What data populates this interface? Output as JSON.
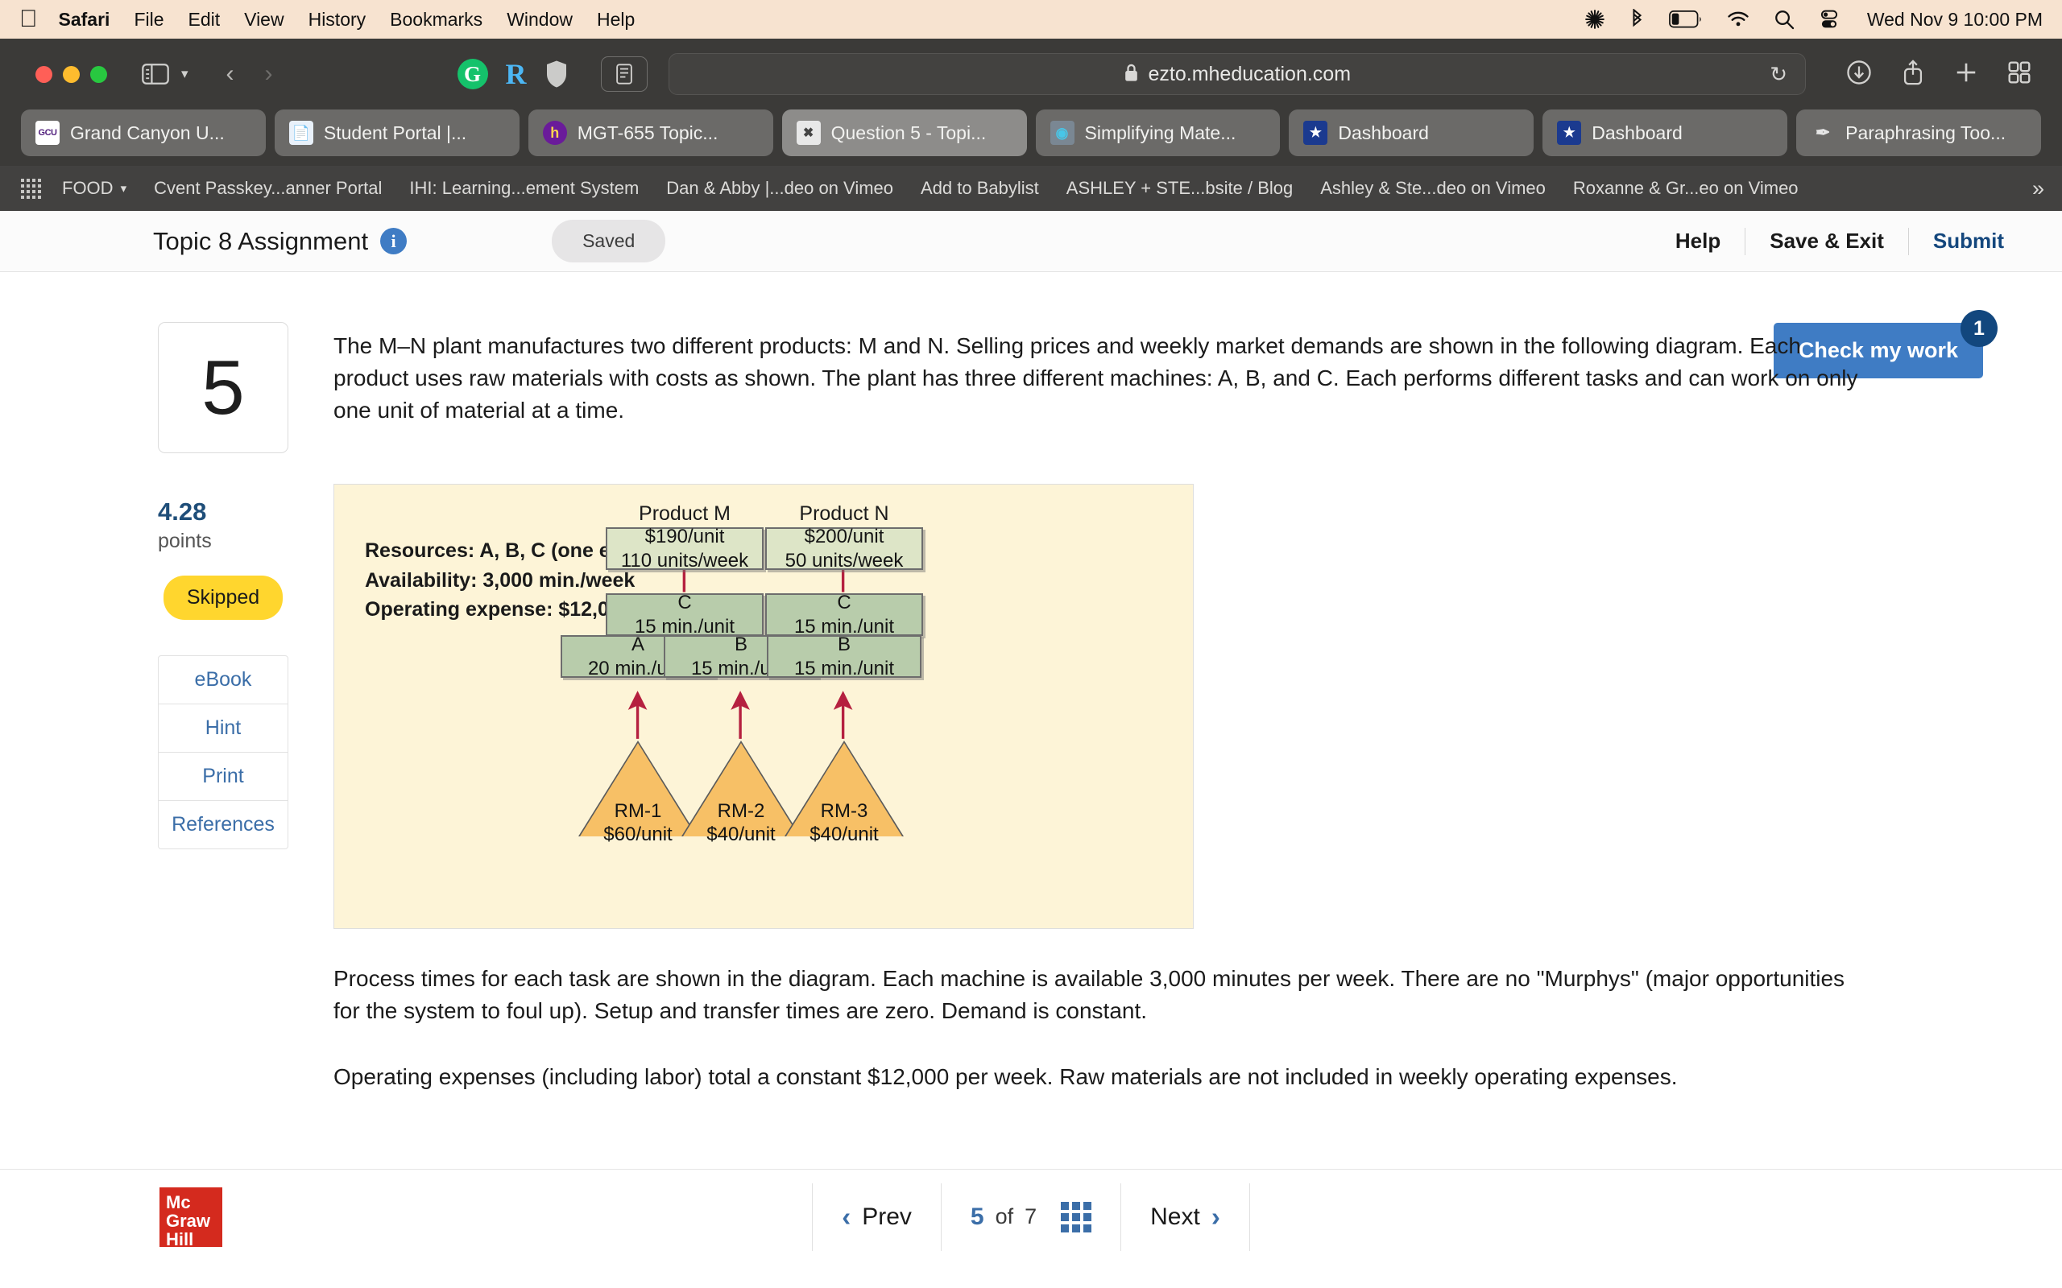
{
  "menubar": {
    "apple_icon": "apple-icon",
    "items": [
      {
        "label": "Safari",
        "bold": true
      },
      {
        "label": "File",
        "bold": false
      },
      {
        "label": "Edit",
        "bold": false
      },
      {
        "label": "View",
        "bold": false
      },
      {
        "label": "History",
        "bold": false
      },
      {
        "label": "Bookmarks",
        "bold": false
      },
      {
        "label": "Window",
        "bold": false
      },
      {
        "label": "Help",
        "bold": false
      }
    ],
    "status_icons": [
      "asterisk-icon",
      "bluetooth-icon",
      "battery-icon",
      "wifi-icon",
      "search-icon",
      "control-center-icon"
    ],
    "clock": "Wed Nov 9  10:00 PM"
  },
  "browser": {
    "window_controls": [
      "close-button",
      "minimize-button",
      "zoom-button"
    ],
    "sidebar_icon": "sidebar-icon",
    "tab_overview_chevron": "chevron-down-icon",
    "back_icon": "chevron-left-icon",
    "forward_icon": "chevron-right-icon",
    "extensions": [
      "grammarly-icon",
      "r-extension-icon",
      "shield-icon",
      "reader-icon"
    ],
    "url": "ezto.mheducation.com",
    "lock_icon": "lock-icon",
    "reload_icon": "reload-icon",
    "right_icons": [
      "downloads-icon",
      "share-icon",
      "new-tab-icon",
      "tab-overview-icon"
    ],
    "tabs": [
      {
        "title": "Grand Canyon U...",
        "favicon": "gcu-icon",
        "active": false
      },
      {
        "title": "Student Portal |...",
        "favicon": "portal-icon",
        "active": false
      },
      {
        "title": "MGT-655 Topic...",
        "favicon": "halo-icon",
        "active": false
      },
      {
        "title": "Question 5 - Topi...",
        "favicon": "connect-icon",
        "active": true
      },
      {
        "title": "Simplifying Mate...",
        "favicon": "simplify-icon",
        "active": false
      },
      {
        "title": "Dashboard",
        "favicon": "star-shield-icon",
        "active": false
      },
      {
        "title": "Dashboard",
        "favicon": "star-shield-icon",
        "active": false
      },
      {
        "title": "Paraphrasing Too...",
        "favicon": "quill-icon",
        "active": false
      }
    ],
    "bookmarks": [
      {
        "label": "FOOD",
        "has_chevron": true
      },
      {
        "label": "Cvent Passkey...anner Portal",
        "has_chevron": false
      },
      {
        "label": "IHI: Learning...ement System",
        "has_chevron": false
      },
      {
        "label": "Dan & Abby |...deo on Vimeo",
        "has_chevron": false
      },
      {
        "label": "Add to Babylist",
        "has_chevron": false
      },
      {
        "label": "ASHLEY + STE...bsite / Blog",
        "has_chevron": false
      },
      {
        "label": "Ashley & Ste...deo on Vimeo",
        "has_chevron": false
      },
      {
        "label": "Roxanne & Gr...eo on Vimeo",
        "has_chevron": false
      }
    ],
    "bookmarks_overflow": "»",
    "apps_grid_icon": "apps-grid-icon"
  },
  "app": {
    "title": "Topic 8 Assignment",
    "info_icon": "info-icon",
    "save_status": "Saved",
    "help_label": "Help",
    "save_exit_label": "Save & Exit",
    "submit_label": "Submit",
    "check_work_label": "Check my work",
    "check_work_badge": "1"
  },
  "question": {
    "number": "5",
    "points_value": "4.28",
    "points_label": "points",
    "status": "Skipped",
    "aids": [
      {
        "label": "eBook"
      },
      {
        "label": "Hint"
      },
      {
        "label": "Print"
      },
      {
        "label": "References"
      }
    ],
    "paragraph_1": "The M–N plant manufactures two different products: M and N. Selling prices and weekly market demands are shown in the following diagram. Each product uses raw materials with costs as shown. The plant has three different machines: A, B, and C. Each performs different tasks and can work on only one unit of material at a time.",
    "paragraph_2": "Process times for each task are shown in the diagram. Each machine is available 3,000 minutes per week. There are no \"Murphys\" (major opportunities for the system to foul up). Setup and transfer times are zero. Demand is constant.",
    "paragraph_3": "Operating expenses (including labor) total a constant $12,000 per week. Raw materials are not included in weekly operating expenses."
  },
  "diagram": {
    "legend": "Resources:  A, B, C (one each)\nAvailability:  3,000 min./week\nOperating expense:  $12,000/week",
    "product_m_label": "Product M",
    "product_n_label": "Product N",
    "product_m_price": "$190/unit",
    "product_m_demand": "110 units/week",
    "product_n_price": "$200/unit",
    "product_n_demand": "50 units/week",
    "machine_c_left_name": "C",
    "machine_c_left_time": "15 min./unit",
    "machine_c_right_name": "C",
    "machine_c_right_time": "15 min./unit",
    "machine_a_name": "A",
    "machine_a_time": "20 min./unit",
    "machine_b1_name": "B",
    "machine_b1_time": "15 min./unit",
    "machine_b2_name": "B",
    "machine_b2_time": "15 min./unit",
    "rm1_name": "RM-1",
    "rm1_cost": "$60/unit",
    "rm2_name": "RM-2",
    "rm2_cost": "$40/unit",
    "rm3_name": "RM-3",
    "rm3_cost": "$40/unit",
    "arrow_color": "#b5203f",
    "background_color": "#fdf4d7",
    "product_box_color": "#dde5c7",
    "machine_box_color": "#b8ccab",
    "raw_material_color": "#f7c066"
  },
  "footer": {
    "brand": "Mc\nGraw\nHill",
    "prev_label": "Prev",
    "current_page": "5",
    "of_label": "of",
    "total_pages": "7",
    "grid_icon": "question-grid-icon",
    "next_label": "Next",
    "prev_icon": "chevron-left-icon",
    "next_icon": "chevron-right-icon"
  }
}
